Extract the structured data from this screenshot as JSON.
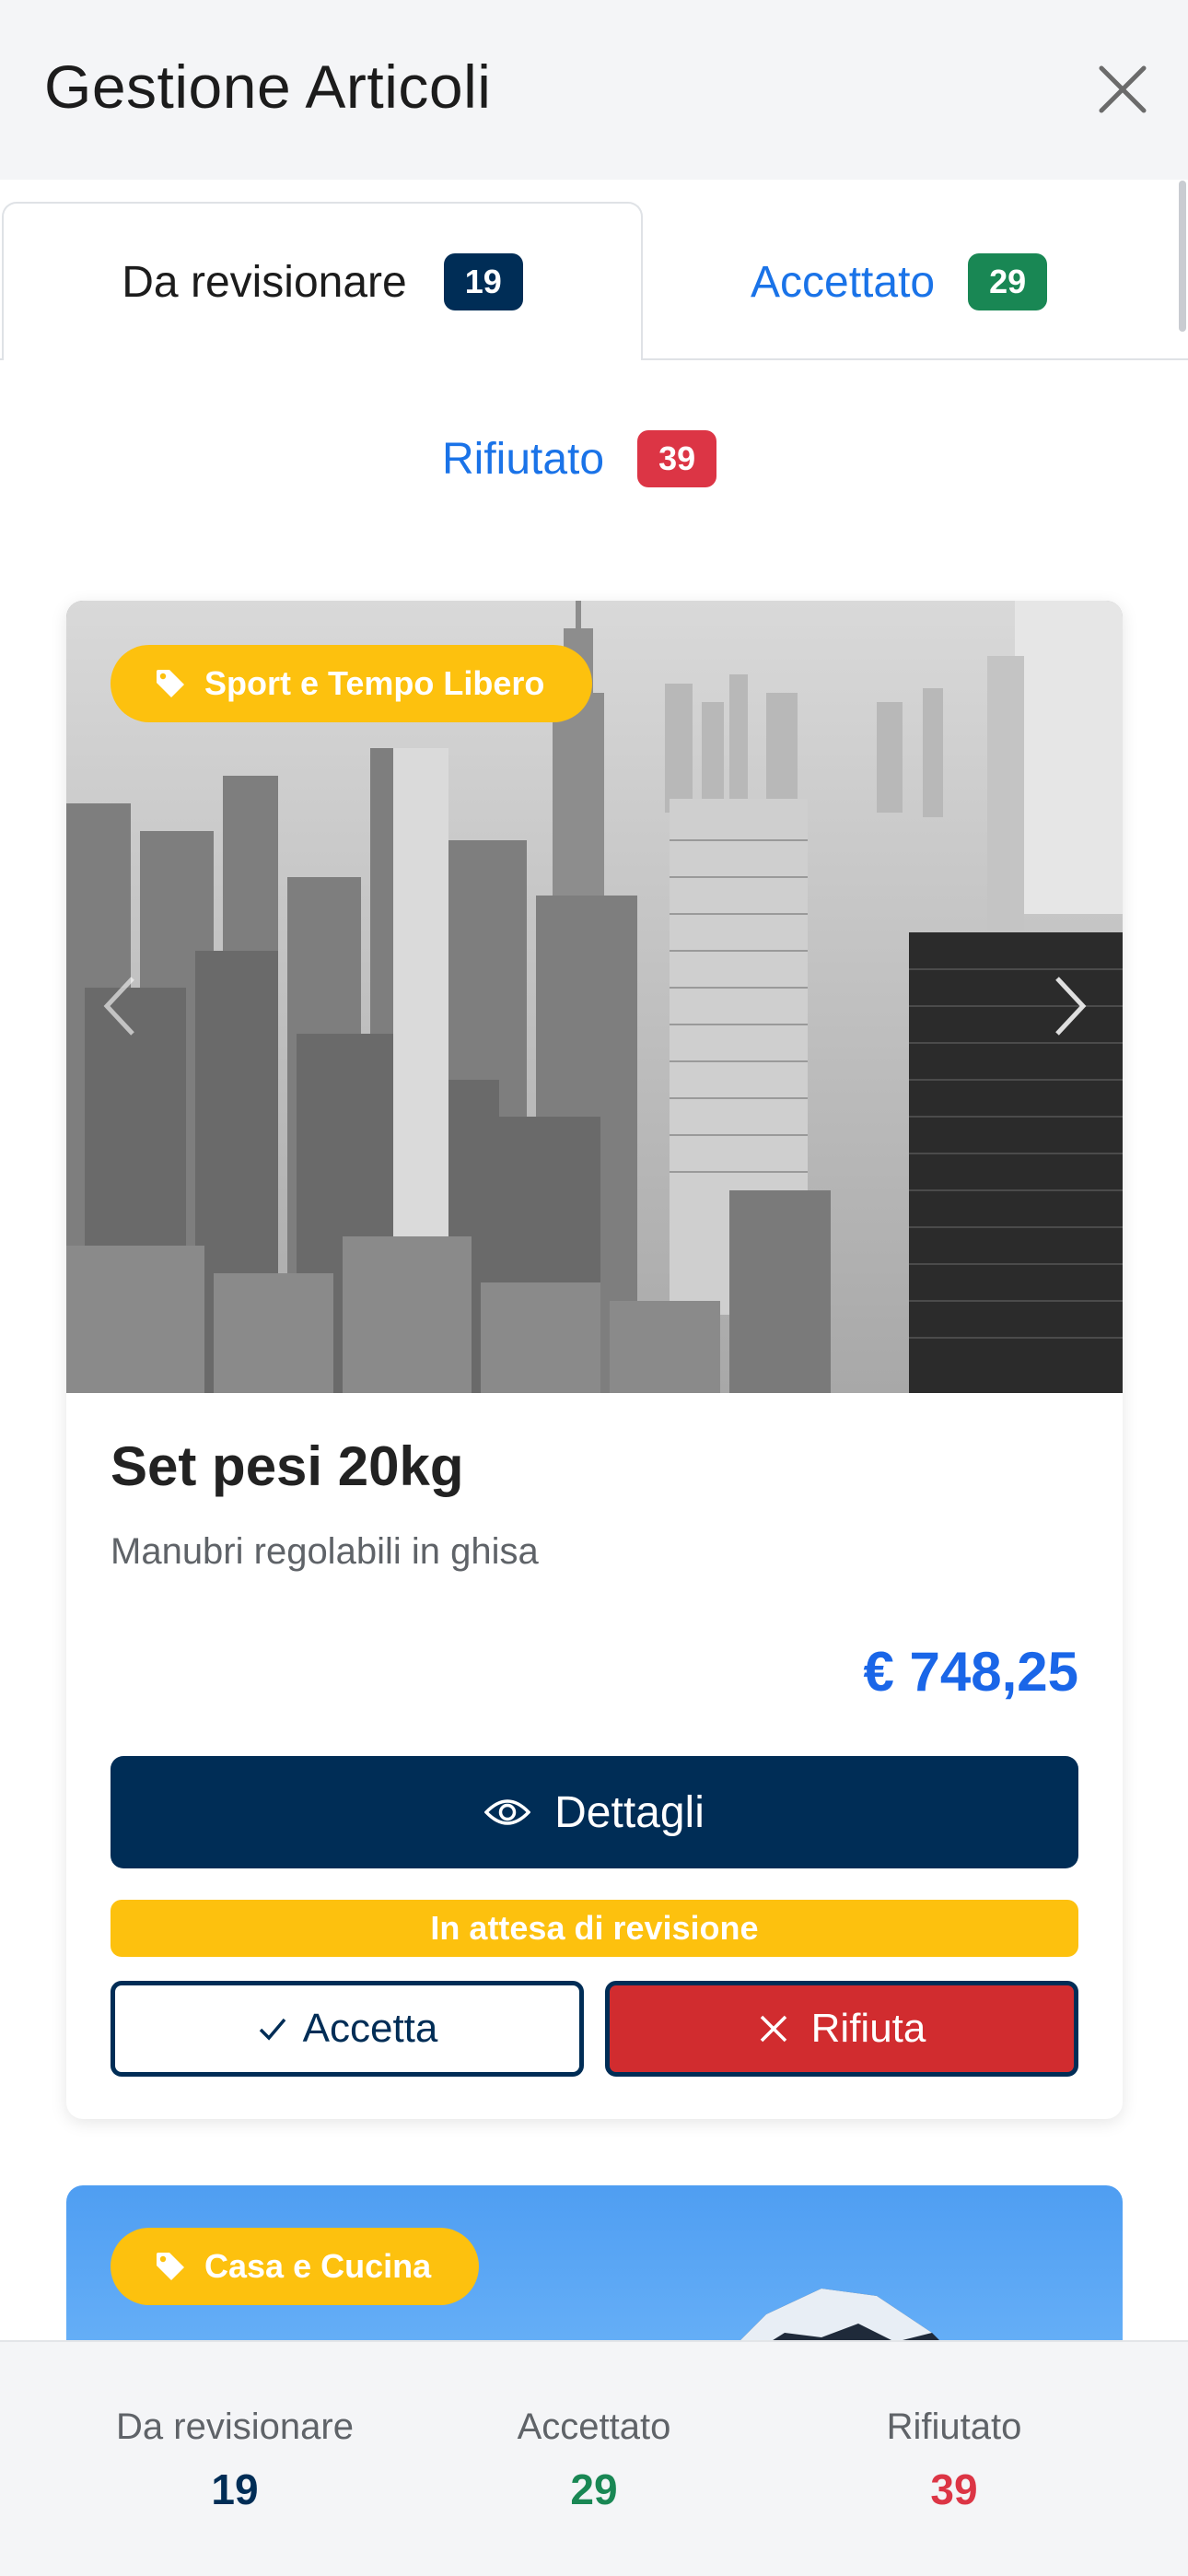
{
  "header": {
    "title": "Gestione Articoli",
    "close_icon": "close-icon"
  },
  "tabs": [
    {
      "label": "Da revisionare",
      "count": "19",
      "badge_color": "#002d56",
      "active": true
    },
    {
      "label": "Accettato",
      "count": "29",
      "badge_color": "#198754",
      "active": false
    },
    {
      "label": "Rifiutato",
      "count": "39",
      "badge_color": "#dc3545",
      "active": false
    }
  ],
  "cards": [
    {
      "category": "Sport e Tempo Libero",
      "category_icon": "tag-icon",
      "title": "Set pesi 20kg",
      "description": "Manubri regolabili in ghisa",
      "price": "€ 748,25",
      "details_label": "Dettagli",
      "status": "In attesa di revisione",
      "accept_label": "Accetta",
      "reject_label": "Rifiuta"
    },
    {
      "category": "Casa e Cucina",
      "category_icon": "tag-icon"
    }
  ],
  "footer": [
    {
      "label": "Da revisionare",
      "value": "19",
      "color": "#002d56"
    },
    {
      "label": "Accettato",
      "value": "29",
      "color": "#198754"
    },
    {
      "label": "Rifiutato",
      "value": "39",
      "color": "#dc3545"
    }
  ],
  "colors": {
    "primary": "#002d56",
    "accent": "#fdc10e",
    "link": "#1a73e8",
    "price": "#1a66e8",
    "danger": "#d12c2f"
  }
}
